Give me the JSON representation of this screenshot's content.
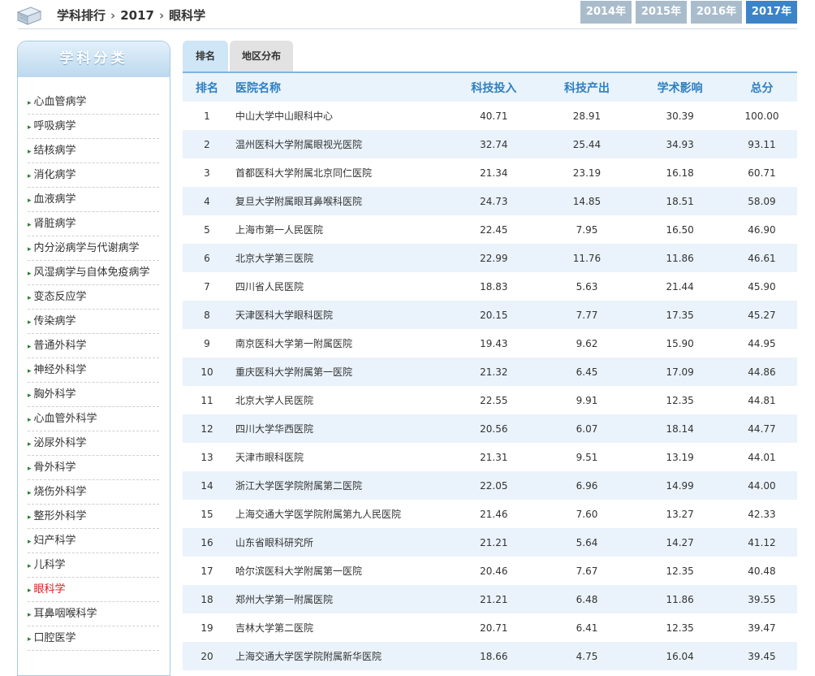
{
  "header": {
    "breadcrumb": [
      "学科排行",
      "2017",
      "眼科学"
    ],
    "years": [
      {
        "label": "2014年",
        "active": false
      },
      {
        "label": "2015年",
        "active": false
      },
      {
        "label": "2016年",
        "active": false
      },
      {
        "label": "2017年",
        "active": true
      }
    ]
  },
  "sidebar": {
    "title": "学科分类",
    "items": [
      "心血管病学",
      "呼吸病学",
      "结核病学",
      "消化病学",
      "血液病学",
      "肾脏病学",
      "内分泌病学与代谢病学",
      "风湿病学与自体免疫病学",
      "变态反应学",
      "传染病学",
      "普通外科学",
      "神经外科学",
      "胸外科学",
      "心血管外科学",
      "泌尿外科学",
      "骨外科学",
      "烧伤外科学",
      "整形外科学",
      "妇产科学",
      "儿科学",
      "眼科学",
      "耳鼻咽喉科学",
      "口腔医学"
    ],
    "active_item": "眼科学"
  },
  "tabs": [
    {
      "label": "排名",
      "active": true
    },
    {
      "label": "地区分布",
      "active": false
    }
  ],
  "table": {
    "headers": [
      "排名",
      "医院名称",
      "科技投入",
      "科技产出",
      "学术影响",
      "总分"
    ],
    "rows": [
      [
        "1",
        "中山大学中山眼科中心",
        "40.71",
        "28.91",
        "30.39",
        "100.00"
      ],
      [
        "2",
        "温州医科大学附属眼视光医院",
        "32.74",
        "25.44",
        "34.93",
        "93.11"
      ],
      [
        "3",
        "首都医科大学附属北京同仁医院",
        "21.34",
        "23.19",
        "16.18",
        "60.71"
      ],
      [
        "4",
        "复旦大学附属眼耳鼻喉科医院",
        "24.73",
        "14.85",
        "18.51",
        "58.09"
      ],
      [
        "5",
        "上海市第一人民医院",
        "22.45",
        "7.95",
        "16.50",
        "46.90"
      ],
      [
        "6",
        "北京大学第三医院",
        "22.99",
        "11.76",
        "11.86",
        "46.61"
      ],
      [
        "7",
        "四川省人民医院",
        "18.83",
        "5.63",
        "21.44",
        "45.90"
      ],
      [
        "8",
        "天津医科大学眼科医院",
        "20.15",
        "7.77",
        "17.35",
        "45.27"
      ],
      [
        "9",
        "南京医科大学第一附属医院",
        "19.43",
        "9.62",
        "15.90",
        "44.95"
      ],
      [
        "10",
        "重庆医科大学附属第一医院",
        "21.32",
        "6.45",
        "17.09",
        "44.86"
      ],
      [
        "11",
        "北京大学人民医院",
        "22.55",
        "9.91",
        "12.35",
        "44.81"
      ],
      [
        "12",
        "四川大学华西医院",
        "20.56",
        "6.07",
        "18.14",
        "44.77"
      ],
      [
        "13",
        "天津市眼科医院",
        "21.31",
        "9.51",
        "13.19",
        "44.01"
      ],
      [
        "14",
        "浙江大学医学院附属第二医院",
        "22.05",
        "6.96",
        "14.99",
        "44.00"
      ],
      [
        "15",
        "上海交通大学医学院附属第九人民医院",
        "21.46",
        "7.60",
        "13.27",
        "42.33"
      ],
      [
        "16",
        "山东省眼科研究所",
        "21.21",
        "5.64",
        "14.27",
        "41.12"
      ],
      [
        "17",
        "哈尔滨医科大学附属第一医院",
        "20.46",
        "7.67",
        "12.35",
        "40.48"
      ],
      [
        "18",
        "郑州大学第一附属医院",
        "21.21",
        "6.48",
        "11.86",
        "39.55"
      ],
      [
        "19",
        "吉林大学第二医院",
        "20.71",
        "6.41",
        "12.35",
        "39.47"
      ],
      [
        "20",
        "上海交通大学医学院附属新华医院",
        "18.66",
        "4.75",
        "16.04",
        "39.45"
      ]
    ]
  },
  "colors": {
    "accent": "#3b84c8",
    "year_inactive": "#a9bccb",
    "header_text": "#2f7fc1",
    "active_item": "#e0161e",
    "row_alt": "#eaf3fb"
  },
  "icons": {
    "logo": "book-stack-icon",
    "breadcrumb_separator": "chevron-right-icon",
    "list_bullet": "triangle-bullet-icon"
  }
}
